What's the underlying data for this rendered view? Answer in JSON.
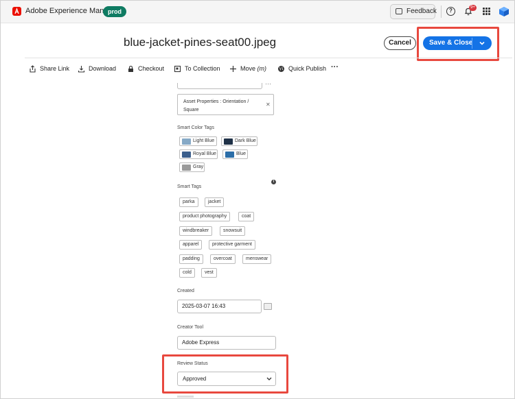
{
  "appbar": {
    "title": "Adobe Experience Manager",
    "env_badge": "prod",
    "feedback_label": "Feedback",
    "help_icon": "help-icon",
    "bell_icon": "bell-icon",
    "notification_count": "9+",
    "apps_icon": "apps-grid-icon",
    "profile_icon": "profile-icon"
  },
  "header": {
    "file_name": "blue-jacket-pines-seat00.jpeg",
    "cancel_label": "Cancel",
    "save_label": "Save & Close"
  },
  "actions": [
    {
      "label": "Share Link",
      "icon": "share-icon"
    },
    {
      "label": "Download",
      "icon": "download-icon"
    },
    {
      "label": "Checkout",
      "icon": "lock-icon"
    },
    {
      "label": "To Collection",
      "icon": "collection-icon"
    },
    {
      "label": "Move",
      "hint": "(m)",
      "icon": "move-icon"
    },
    {
      "label": "Quick Publish",
      "icon": "globe-icon"
    },
    {
      "label": "More actions",
      "icon": "more-icon"
    }
  ],
  "form": {
    "tag_value": "Asset Properties : Orientation / Square",
    "smart_color_tags_label": "Smart Color Tags",
    "color_tags": [
      {
        "label": "Light Blue",
        "color": "#86a9c6"
      },
      {
        "label": "Dark Blue",
        "color": "#1f3147"
      },
      {
        "label": "Royal Blue",
        "color": "#3c5f8c"
      },
      {
        "label": "Blue",
        "color": "#2c6ea8"
      },
      {
        "label": "Gray",
        "color": "#9a9a9a"
      }
    ],
    "smart_tags_label": "Smart Tags",
    "smart_tags": [
      "parka",
      "jacket",
      "product photography",
      "coat",
      "windbreaker",
      "snowsuit",
      "apparel",
      "protective garment",
      "padding",
      "overcoat",
      "menswear",
      "cold",
      "vest"
    ],
    "created_label": "Created",
    "created_value": "2025-03-07 16:43",
    "creator_tool_label": "Creator Tool",
    "creator_tool_value": "Adobe Express",
    "review_status_label": "Review Status",
    "review_status_value": "Approved"
  },
  "colors": {
    "accent": "#1473e6",
    "highlight": "#e8483e",
    "badge": "#0f7b62"
  }
}
